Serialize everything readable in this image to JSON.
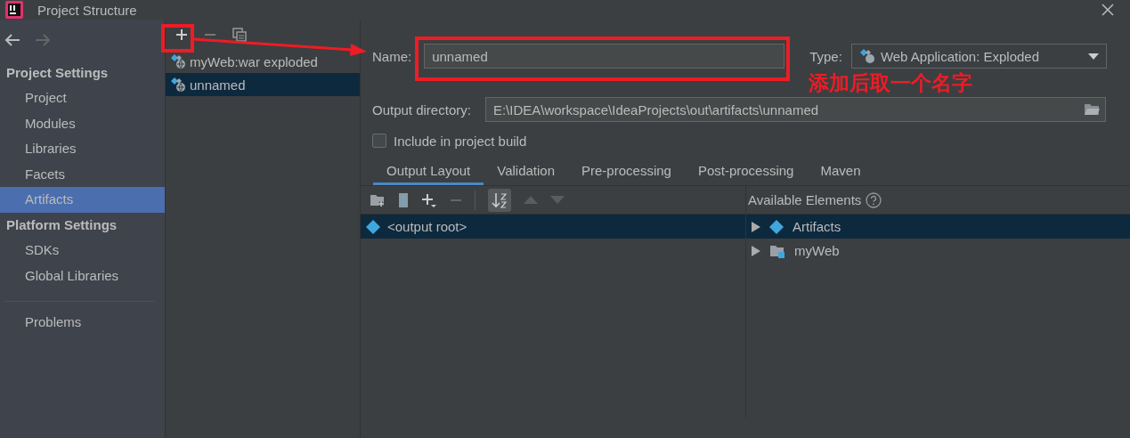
{
  "window": {
    "title": "Project Structure"
  },
  "sidebar": {
    "sections": [
      {
        "heading": "Project Settings",
        "items": [
          {
            "label": "Project",
            "selected": false
          },
          {
            "label": "Modules",
            "selected": false
          },
          {
            "label": "Libraries",
            "selected": false
          },
          {
            "label": "Facets",
            "selected": false
          },
          {
            "label": "Artifacts",
            "selected": true
          }
        ]
      },
      {
        "heading": "Platform Settings",
        "items": [
          {
            "label": "SDKs",
            "selected": false
          },
          {
            "label": "Global Libraries",
            "selected": false
          }
        ]
      }
    ],
    "footer_items": [
      {
        "label": "Problems",
        "selected": false
      }
    ]
  },
  "artifacts": [
    {
      "label": "myWeb:war exploded",
      "selected": false
    },
    {
      "label": "unnamed",
      "selected": true
    }
  ],
  "form": {
    "name_label": "Name:",
    "name_value": "unnamed",
    "type_label": "Type:",
    "type_value": "Web Application: Exploded",
    "output_label": "Output directory:",
    "output_value": "E:\\IDEA\\workspace\\IdeaProjects\\out\\artifacts\\unnamed",
    "include_label": "Include in project build",
    "include_checked": false
  },
  "tabs": [
    {
      "label": "Output Layout",
      "selected": true
    },
    {
      "label": "Validation",
      "selected": false
    },
    {
      "label": "Pre-processing",
      "selected": false
    },
    {
      "label": "Post-processing",
      "selected": false
    },
    {
      "label": "Maven",
      "selected": false
    }
  ],
  "layout_tree": [
    {
      "label": "<output root>",
      "selected": true
    }
  ],
  "available": {
    "title": "Available Elements",
    "items": [
      {
        "label": "Artifacts",
        "kind": "artifact",
        "expanded": false,
        "selected": true
      },
      {
        "label": "myWeb",
        "kind": "module",
        "expanded": false,
        "selected": false
      }
    ]
  },
  "annotation": {
    "text": "添加后取一个名字"
  }
}
